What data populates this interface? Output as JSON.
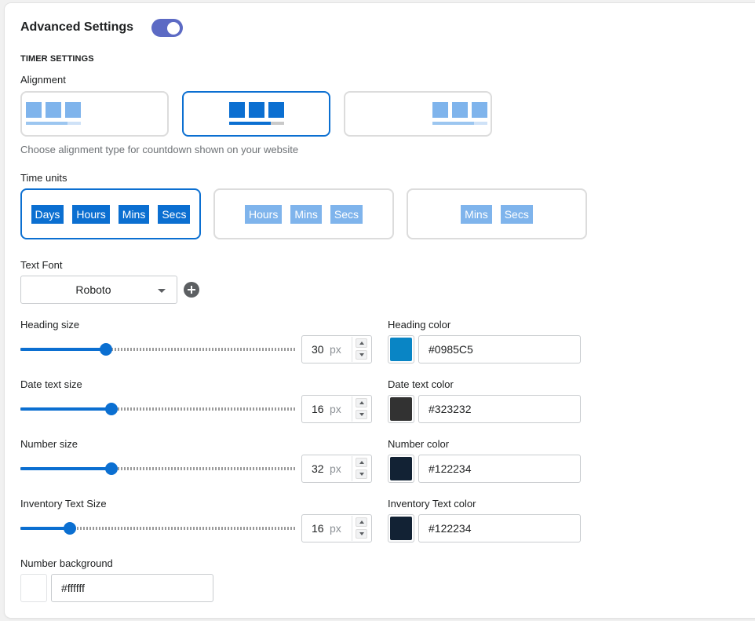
{
  "header": {
    "title": "Advanced Settings",
    "toggle_on": true,
    "toggle_color": "#5c6ac4"
  },
  "timer": {
    "section_title": "TIMER SETTINGS",
    "alignment": {
      "label": "Alignment",
      "options": [
        {
          "name": "left",
          "selected": false
        },
        {
          "name": "center",
          "selected": true
        },
        {
          "name": "right",
          "selected": false
        }
      ],
      "help": "Choose alignment type for countdown shown on your website"
    },
    "time_units": {
      "label": "Time units",
      "options": [
        {
          "units": [
            "Days",
            "Hours",
            "Mins",
            "Secs"
          ],
          "selected": true
        },
        {
          "units": [
            "Hours",
            "Mins",
            "Secs"
          ],
          "selected": false
        },
        {
          "units": [
            "Mins",
            "Secs"
          ],
          "selected": false
        }
      ]
    }
  },
  "font": {
    "label": "Text Font",
    "value": "Roboto",
    "add_icon": "plus-circle-icon"
  },
  "sizes": [
    {
      "label": "Heading size",
      "value": "30",
      "unit": "px",
      "fraction": 0.31
    },
    {
      "label": "Date text size",
      "value": "16",
      "unit": "px",
      "fraction": 0.33
    },
    {
      "label": "Number size",
      "value": "32",
      "unit": "px",
      "fraction": 0.33
    },
    {
      "label": "Inventory Text Size",
      "value": "16",
      "unit": "px",
      "fraction": 0.18
    }
  ],
  "colors": [
    {
      "label": "Heading color",
      "hex": "#0985C5"
    },
    {
      "label": "Date text color",
      "hex": "#323232"
    },
    {
      "label": "Number color",
      "hex": "#122234"
    },
    {
      "label": "Inventory Text color",
      "hex": "#122234"
    }
  ],
  "number_background": {
    "label": "Number background",
    "hex": "#ffffff"
  },
  "accent_color": "#0b6fd1"
}
